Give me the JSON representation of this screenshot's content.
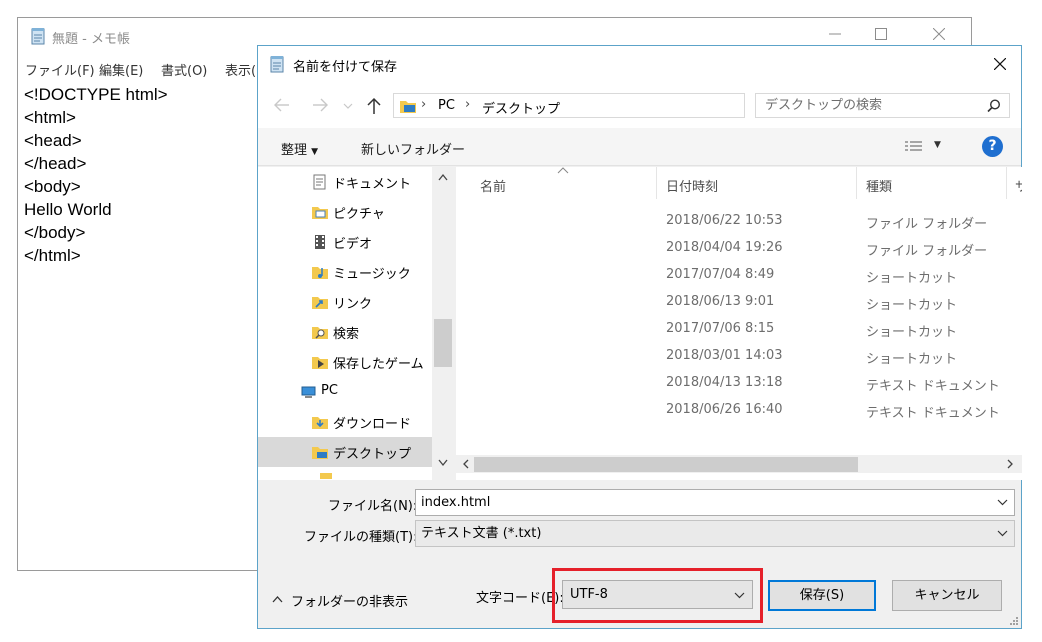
{
  "notepad": {
    "title": "無題 - メモ帳",
    "menu": [
      "ファイル(F)",
      "編集(E)",
      "書式(O)",
      "表示("
    ],
    "content_lines": [
      "<!DOCTYPE html>",
      "<html>",
      "<head>",
      "</head>",
      "<body>",
      "Hello World",
      "</body>",
      "</html>"
    ]
  },
  "dialog": {
    "title": "名前を付けて保存",
    "breadcrumb": [
      "PC",
      "デスクトップ"
    ],
    "search_placeholder": "デスクトップの検索",
    "toolbar": {
      "organize": "整理",
      "new_folder": "新しいフォルダー"
    },
    "help_label": "?",
    "tree": [
      {
        "label": "ドキュメント",
        "icon": "document-folder-icon"
      },
      {
        "label": "ピクチャ",
        "icon": "pictures-folder-icon"
      },
      {
        "label": "ビデオ",
        "icon": "videos-folder-icon"
      },
      {
        "label": "ミュージック",
        "icon": "music-folder-icon"
      },
      {
        "label": "リンク",
        "icon": "links-folder-icon"
      },
      {
        "label": "検索",
        "icon": "search-folder-icon"
      },
      {
        "label": "保存したゲーム",
        "icon": "saved-games-folder-icon"
      },
      {
        "label": "PC",
        "icon": "pc-icon"
      },
      {
        "label": "ダウンロード",
        "icon": "downloads-folder-icon"
      },
      {
        "label": "デスクトップ",
        "icon": "desktop-folder-icon"
      }
    ],
    "columns": {
      "name": "名前",
      "date": "日付時刻",
      "type": "種類",
      "size": "サ"
    },
    "files": [
      {
        "date": "2018/06/22 10:53",
        "type": "ファイル フォルダー"
      },
      {
        "date": "2018/04/04 19:26",
        "type": "ファイル フォルダー"
      },
      {
        "date": "2017/07/04 8:49",
        "type": "ショートカット"
      },
      {
        "date": "2018/06/13 9:01",
        "type": "ショートカット"
      },
      {
        "date": "2017/07/06 8:15",
        "type": "ショートカット"
      },
      {
        "date": "2018/03/01 14:03",
        "type": "ショートカット"
      },
      {
        "date": "2018/04/13 13:18",
        "type": "テキスト ドキュメント"
      },
      {
        "date": "2018/06/26 16:40",
        "type": "テキスト ドキュメント"
      }
    ],
    "filename_label": "ファイル名(N):",
    "filename_value": "index.html",
    "filetype_label": "ファイルの種類(T):",
    "filetype_value": "テキスト文書 (*.txt)",
    "hide_folders": "フォルダーの非表示",
    "encoding_label": "文字コード(E):",
    "encoding_value": "UTF-8",
    "save_button": "保存(S)",
    "cancel_button": "キャンセル"
  },
  "colors": {
    "highlight": "#e5202a",
    "accent": "#0078d7",
    "help": "#1f6fd0"
  }
}
